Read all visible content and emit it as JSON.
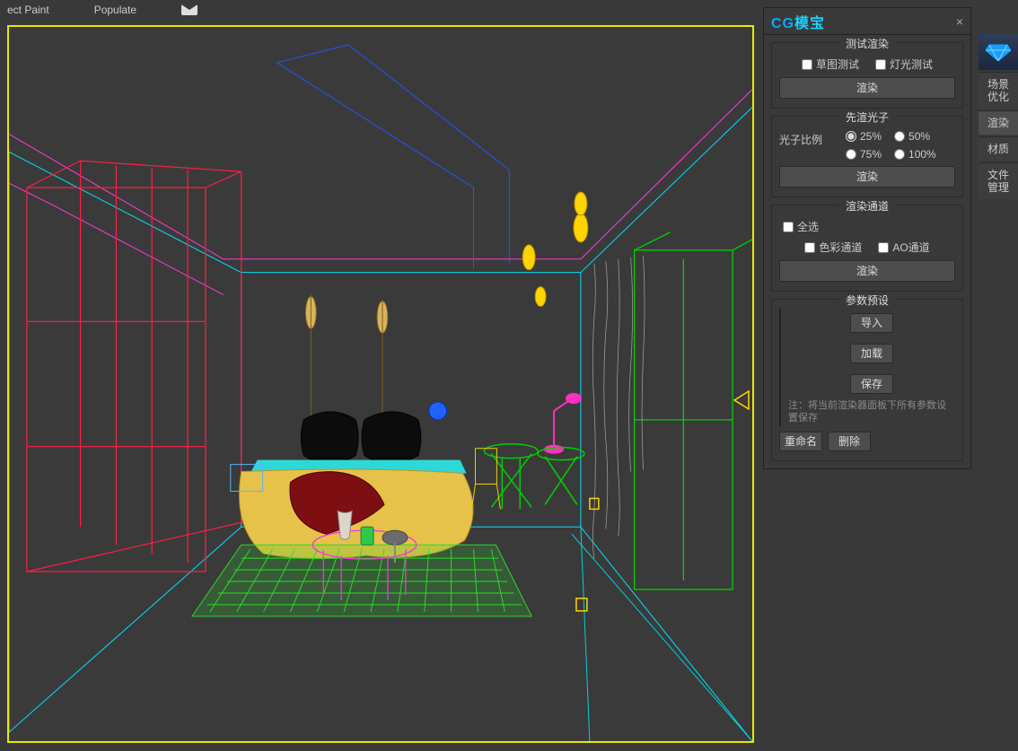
{
  "menu": {
    "item1": "ect Paint",
    "item2": "Populate"
  },
  "panel": {
    "brand_cg": "CG",
    "brand_mb": "模宝",
    "test_render_title": "测试渲染",
    "sketch_test": "草图测试",
    "light_test": "灯光测试",
    "render_btn": "渲染",
    "photon_title": "先渲光子",
    "photon_ratio": "光子比例",
    "p25": "25%",
    "p50": "50%",
    "p75": "75%",
    "p100": "100%",
    "channel_title": "渲染通道",
    "select_all": "全选",
    "color_channel": "色彩通道",
    "ao_channel": "AO通道",
    "preset_title": "参数预设",
    "import": "导入",
    "load": "加载",
    "save": "保存",
    "note": "注：将当前渲染器面板下所有参数设置保存",
    "rename": "重命名",
    "delete": "删除"
  },
  "sidebar": {
    "scene_opt": "场景\n优化",
    "render": "渲染",
    "material": "材质",
    "file_mgr": "文件\n管理"
  }
}
